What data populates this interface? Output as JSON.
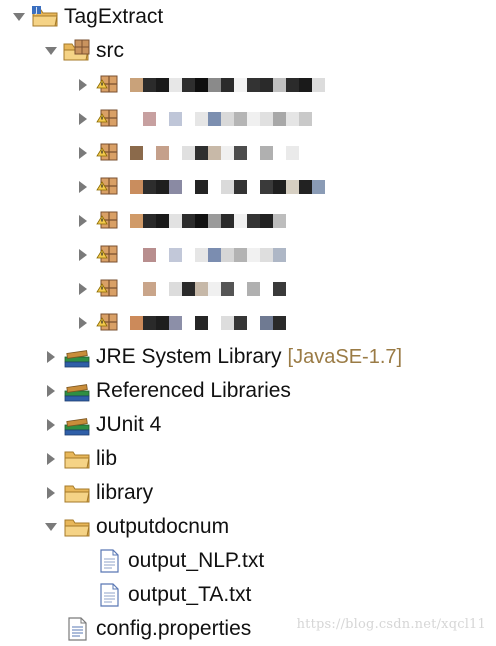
{
  "project": {
    "name": "TagExtract"
  },
  "source_folder": {
    "name": "src"
  },
  "packages": [
    {
      "name": "",
      "blocks": [
        "#c9a27a",
        "#2b2b2b",
        "#1a1a1a",
        "#e7e7e7",
        "#2e2e2e",
        "#0f0f0f",
        "#8a8a8a",
        "#2b2b2b",
        "#f2f2f2",
        "#333333",
        "#2a2a2a",
        "#c0c0c0",
        "#2b2b2b",
        "#1a1a1a",
        "#dcdcdc"
      ]
    },
    {
      "name": "",
      "blocks": [
        "#ffffff",
        "#c7a0a0",
        "#ffffff",
        "#bfc6d8",
        "#ffffff",
        "#e6e6e6",
        "#7c8fb0",
        "#d9d9d9",
        "#b5b5b5",
        "#f0f0f0",
        "#e0e0e0",
        "#a8a8a8",
        "#e5e5e5",
        "#c9c9c9"
      ]
    },
    {
      "name": "",
      "blocks": [
        "#8b6a4b",
        "#ffffff",
        "#c5a08b",
        "#ffffff",
        "#e0e0e0",
        "#2f2f2f",
        "#c8b9a8",
        "#f0f0f0",
        "#4d4d4d",
        "#ffffff",
        "#b0b0b0",
        "#ffffff",
        "#eaeaea"
      ]
    },
    {
      "name": "",
      "blocks": [
        "#c98d5e",
        "#2d2d2d",
        "#1e1e1e",
        "#8a8aa3",
        "#ffffff",
        "#242424",
        "#ffffff",
        "#dadada",
        "#343434",
        "#ffffff",
        "#3a3a3a",
        "#1f1f1f",
        "#d6cfc2",
        "#222222",
        "#8a9bb5"
      ]
    },
    {
      "name": "",
      "blocks": [
        "#d09a68",
        "#2a2a2a",
        "#1a1a1a",
        "#e2e2e2",
        "#2c2c2c",
        "#111111",
        "#9a9a9a",
        "#2a2a2a",
        "#f0f0f0",
        "#343434",
        "#222222",
        "#bdbdbd"
      ]
    },
    {
      "name": "",
      "blocks": [
        "#ffffff",
        "#b88e8e",
        "#ffffff",
        "#c2c8d9",
        "#ffffff",
        "#e6e6e6",
        "#7b8db0",
        "#d6d6d6",
        "#b3b3b3",
        "#f1f1f1",
        "#dedede",
        "#aeb7c6"
      ]
    },
    {
      "name": "",
      "blocks": [
        "#ffffff",
        "#c9a58a",
        "#ffffff",
        "#dcdcdc",
        "#2a2a2a",
        "#c6b8a8",
        "#f0f0f0",
        "#555555",
        "#ffffff",
        "#b0b0b0",
        "#ffffff",
        "#3a3a3a"
      ]
    },
    {
      "name": "",
      "blocks": [
        "#cc8a5a",
        "#2a2a2a",
        "#1e1e1e",
        "#8c8fa8",
        "#ffffff",
        "#262626",
        "#ffffff",
        "#dddddd",
        "#363636",
        "#ffffff",
        "#6f7a92",
        "#2a2a2a"
      ]
    }
  ],
  "libraries": [
    {
      "label": "JRE System Library",
      "decoration": "[JavaSE-1.7]"
    },
    {
      "label": "Referenced Libraries"
    },
    {
      "label": "JUnit 4"
    }
  ],
  "folders": [
    {
      "label": "lib"
    },
    {
      "label": "library"
    },
    {
      "label": "outputdocnum"
    }
  ],
  "files": [
    {
      "label": "output_NLP.txt"
    },
    {
      "label": "output_TA.txt"
    }
  ],
  "config_file": {
    "label": "config.properties"
  },
  "watermark": "https://blog.csdn.net/xqcl11",
  "colors": {
    "folder": "#e8b75a",
    "library_book_green": "#2f8f43",
    "library_book_blue": "#2f5fa8",
    "file_blue": "#5a78b5"
  }
}
